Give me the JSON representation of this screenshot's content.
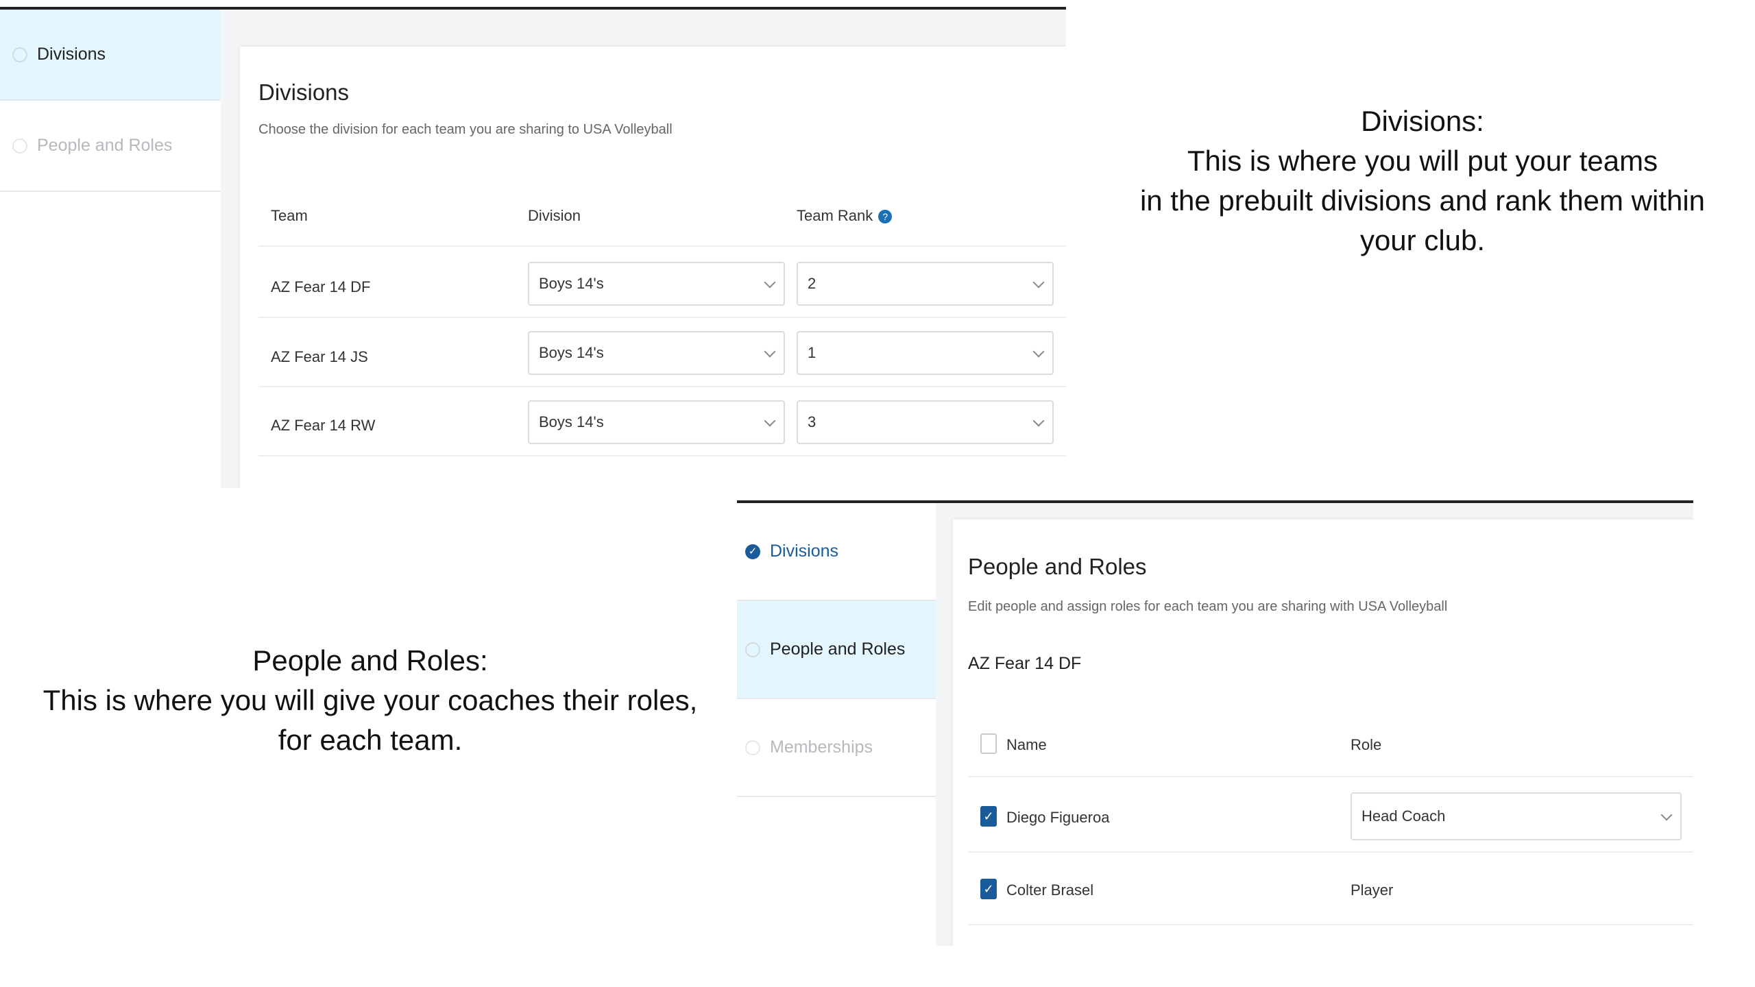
{
  "divisions_screen": {
    "steps": [
      {
        "label": "Divisions",
        "state": "active"
      },
      {
        "label": "People and Roles",
        "state": "pending"
      }
    ],
    "title": "Divisions",
    "subtitle": "Choose the division for each team you are sharing to USA Volleyball",
    "columns": {
      "team": "Team",
      "division": "Division",
      "rank": "Team Rank"
    },
    "help_icon": "question-icon",
    "rows": [
      {
        "team": "AZ Fear 14 DF",
        "division": "Boys 14's",
        "rank": "2"
      },
      {
        "team": "AZ Fear 14 JS",
        "division": "Boys 14's",
        "rank": "1"
      },
      {
        "team": "AZ Fear 14 RW",
        "division": "Boys 14's",
        "rank": "3"
      }
    ]
  },
  "people_screen": {
    "steps": [
      {
        "label": "Divisions",
        "state": "complete"
      },
      {
        "label": "People and Roles",
        "state": "active"
      },
      {
        "label": "Memberships",
        "state": "pending"
      }
    ],
    "title": "People and Roles",
    "subtitle": "Edit people and assign roles for each team you are sharing with USA Volleyball",
    "team_name": "AZ Fear 14 DF",
    "columns": {
      "name": "Name",
      "role": "Role"
    },
    "rows": [
      {
        "name": "Diego Figueroa",
        "role": "Head Coach",
        "checked": true,
        "role_editable": true
      },
      {
        "name": "Colter Brasel",
        "role": "Player",
        "checked": true,
        "role_editable": false
      }
    ]
  },
  "annotations": {
    "divisions": {
      "line1": "Divisions:",
      "line2": "This is where you will put your teams",
      "line3": "in the prebuilt divisions and rank them within",
      "line4": "your club."
    },
    "people": {
      "line1": "People and Roles:",
      "line2": "This is where you will give your coaches their roles,",
      "line3": "for each team."
    }
  },
  "colors": {
    "accent": "#1a5c9a",
    "active_step_bg": "#e3f6fd"
  }
}
